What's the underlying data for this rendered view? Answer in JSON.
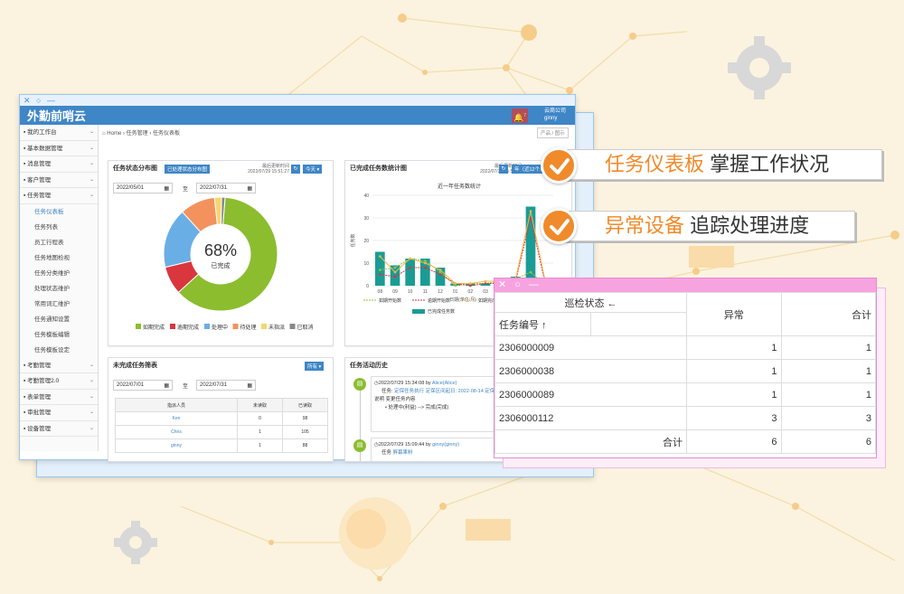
{
  "callouts": [
    {
      "highlight": "任务仪表板",
      "text": "掌握工作状况"
    },
    {
      "highlight": "异常设备",
      "text": "追踪处理进度"
    }
  ],
  "app": {
    "logo": "外勤前哨云",
    "company": "云商公司",
    "user": "ginny",
    "bell_count": "7"
  },
  "sidebar": {
    "items": [
      {
        "label": "我的工作台",
        "icon": "monitor-icon"
      },
      {
        "label": "基本数据管理",
        "icon": "table-icon"
      },
      {
        "label": "消息管理",
        "icon": "chat-icon"
      },
      {
        "label": "客户管理",
        "icon": "user-icon"
      },
      {
        "label": "任务管理",
        "icon": "task-icon"
      }
    ],
    "subitems": [
      "任务仪表板",
      "任务列表",
      "员工行程表",
      "任务地图检视",
      "任务分类维护",
      "处理状态维护",
      "常用词汇维护",
      "任务通知设置",
      "任务模板编辑",
      "任务模板设定"
    ],
    "bottom": [
      {
        "label": "考勤管理",
        "icon": "pin-icon"
      },
      {
        "label": "考勤管理2.0",
        "icon": "pin-icon"
      },
      {
        "label": "表单管理",
        "icon": "form-icon"
      },
      {
        "label": "审批管理",
        "icon": "approve-icon"
      },
      {
        "label": "设备管理",
        "icon": "device-icon"
      }
    ]
  },
  "breadcrumb": {
    "home": "Home",
    "l1": "任务管理",
    "l2": "任务仪表板",
    "btn": "产品 / 图示"
  },
  "status_panel": {
    "title": "任务状态分布图",
    "tag": "已处理状态分布图",
    "update_label": "最后更新时间",
    "update_time": "2022/07/29 15:51:27",
    "range": "今天",
    "date_from": "2022/05/01",
    "date_sep": "至",
    "date_to": "2022/07/31",
    "percent": "68%",
    "center_label": "已完成"
  },
  "stats_panel": {
    "title": "已完成任务数统计图",
    "update_label": "最后更新时间",
    "update_time": "2022/07/29 15:51:27",
    "range": "年（近12个月）"
  },
  "pending_panel": {
    "title": "未完成任务筛表",
    "filter": "所有",
    "date_from": "2022/07/01",
    "date_sep": "至",
    "date_to": "2022/07/31",
    "columns": [
      "指派人员",
      "未读取",
      "已读取"
    ],
    "rows": [
      [
        "Ken",
        "0",
        "98"
      ],
      [
        "Chris",
        "1",
        "105"
      ],
      [
        "ginny",
        "1",
        "88"
      ]
    ]
  },
  "history_panel": {
    "title": "任务活动历史",
    "entries": [
      {
        "time": "2022/07/29 15:34:08",
        "by": "by",
        "user": "Alice(Alice)",
        "task_label": "任务:",
        "task_text": "定保任务执行 定保区间起日: 2022-08-14 定保周期: 每月 完成期限",
        "desc_label": "说明",
        "desc_text": "变更任务内容",
        "bullet": "处理中(利益) --> 完成(完成)"
      },
      {
        "time": "2022/07/29 15:09:44",
        "by": "by",
        "user": "ginny(ginny)",
        "task_label": "任务",
        "task_text": "屏幕果粉"
      }
    ]
  },
  "pivot": {
    "header_col": "巡检状态 ←",
    "row_header": "任务编号 ↑",
    "columns": [
      "异常",
      "合计"
    ],
    "rows": [
      {
        "id": "2306000009",
        "v1": "1",
        "v2": "1"
      },
      {
        "id": "2306000038",
        "v1": "1",
        "v2": "1"
      },
      {
        "id": "2306000089",
        "v1": "1",
        "v2": "1"
      },
      {
        "id": "2306000112",
        "v1": "3",
        "v2": "3"
      }
    ],
    "total_label": "合计",
    "total_v1": "6",
    "total_v2": "6"
  },
  "chart_data": [
    {
      "type": "pie",
      "title": "任务状态分布图",
      "categories": [
        "如期完成",
        "逾期完成",
        "处理中",
        "待处理",
        "未指派",
        "已取消"
      ],
      "values": [
        62,
        8,
        17,
        10,
        2,
        1
      ],
      "colors": [
        "#8cbd2f",
        "#d9363e",
        "#6aaee6",
        "#f3925d",
        "#f7d66b",
        "#888888"
      ]
    },
    {
      "type": "bar",
      "title": "近一年任务数统计",
      "xlabel": "日期(单位:月)",
      "ylabel": "任务数",
      "categories": [
        "08",
        "09",
        "10",
        "11",
        "12",
        "01",
        "02",
        "03",
        "04",
        "05",
        "06",
        "07"
      ],
      "ylim": [
        0,
        40
      ],
      "yticks": [
        0,
        10,
        20,
        30,
        40
      ],
      "series": [
        {
          "name": "已完成任务数",
          "type": "bar",
          "values": [
            15,
            9,
            12,
            12,
            8,
            1,
            1,
            1,
            2,
            4,
            35,
            1
          ],
          "color": "#1a9c94"
        },
        {
          "name": "如期开始数",
          "type": "line",
          "values": [
            7,
            8,
            12,
            11,
            6,
            0,
            1,
            1,
            2,
            3,
            6,
            0
          ],
          "color": "#9ac23c"
        },
        {
          "name": "逾期开始数",
          "type": "line",
          "values": [
            5,
            4,
            8,
            8,
            5,
            1,
            0,
            1,
            1,
            2,
            30,
            0
          ],
          "color": "#d9363e"
        },
        {
          "name": "如期完成数",
          "type": "line",
          "values": [
            13,
            6,
            12,
            10,
            7,
            1,
            1,
            2,
            2,
            3,
            33,
            1
          ],
          "color": "#f3b84a"
        }
      ]
    }
  ]
}
